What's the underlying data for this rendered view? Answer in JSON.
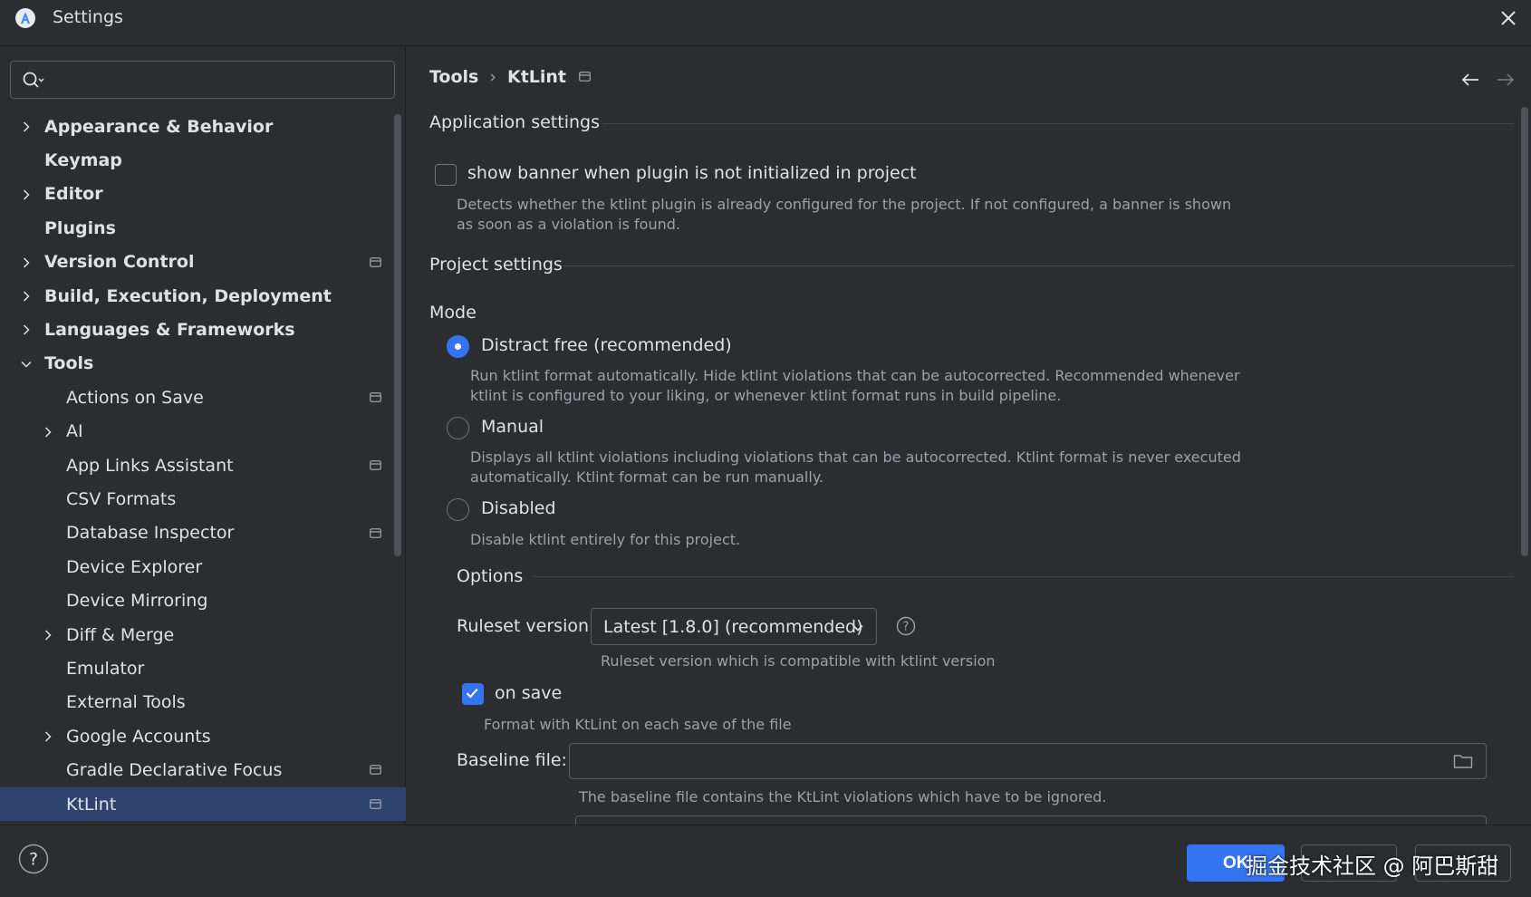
{
  "window": {
    "title": "Settings"
  },
  "search": {
    "placeholder": ""
  },
  "sidebar": {
    "items": [
      {
        "label": "Appearance & Behavior",
        "bold": true,
        "level": 0,
        "expandable": true,
        "expanded": false,
        "project": false
      },
      {
        "label": "Keymap",
        "bold": true,
        "level": 0,
        "expandable": false,
        "expanded": false,
        "project": false
      },
      {
        "label": "Editor",
        "bold": true,
        "level": 0,
        "expandable": true,
        "expanded": false,
        "project": false
      },
      {
        "label": "Plugins",
        "bold": true,
        "level": 0,
        "expandable": false,
        "expanded": false,
        "project": false
      },
      {
        "label": "Version Control",
        "bold": true,
        "level": 0,
        "expandable": true,
        "expanded": false,
        "project": true
      },
      {
        "label": "Build, Execution, Deployment",
        "bold": true,
        "level": 0,
        "expandable": true,
        "expanded": false,
        "project": false
      },
      {
        "label": "Languages & Frameworks",
        "bold": true,
        "level": 0,
        "expandable": true,
        "expanded": false,
        "project": false
      },
      {
        "label": "Tools",
        "bold": true,
        "level": 0,
        "expandable": true,
        "expanded": true,
        "project": false
      },
      {
        "label": "Actions on Save",
        "bold": false,
        "level": 1,
        "expandable": false,
        "expanded": false,
        "project": true
      },
      {
        "label": "AI",
        "bold": false,
        "level": 1,
        "expandable": true,
        "expanded": false,
        "project": false
      },
      {
        "label": "App Links Assistant",
        "bold": false,
        "level": 1,
        "expandable": false,
        "expanded": false,
        "project": true
      },
      {
        "label": "CSV Formats",
        "bold": false,
        "level": 1,
        "expandable": false,
        "expanded": false,
        "project": false
      },
      {
        "label": "Database Inspector",
        "bold": false,
        "level": 1,
        "expandable": false,
        "expanded": false,
        "project": true
      },
      {
        "label": "Device Explorer",
        "bold": false,
        "level": 1,
        "expandable": false,
        "expanded": false,
        "project": false
      },
      {
        "label": "Device Mirroring",
        "bold": false,
        "level": 1,
        "expandable": false,
        "expanded": false,
        "project": false
      },
      {
        "label": "Diff & Merge",
        "bold": false,
        "level": 1,
        "expandable": true,
        "expanded": false,
        "project": false
      },
      {
        "label": "Emulator",
        "bold": false,
        "level": 1,
        "expandable": false,
        "expanded": false,
        "project": false
      },
      {
        "label": "External Tools",
        "bold": false,
        "level": 1,
        "expandable": false,
        "expanded": false,
        "project": false
      },
      {
        "label": "Google Accounts",
        "bold": false,
        "level": 1,
        "expandable": true,
        "expanded": false,
        "project": false
      },
      {
        "label": "Gradle Declarative Focus",
        "bold": false,
        "level": 1,
        "expandable": false,
        "expanded": false,
        "project": true
      },
      {
        "label": "KtLint",
        "bold": false,
        "level": 1,
        "expandable": false,
        "expanded": false,
        "project": true,
        "selected": true
      }
    ]
  },
  "breadcrumb": {
    "parent": "Tools",
    "separator": "›",
    "current": "KtLint"
  },
  "application_settings": {
    "title": "Application settings",
    "banner_checkbox": {
      "label": "show banner when plugin is not initialized in project",
      "checked": false,
      "description": "Detects whether the ktlint plugin is already configured for the project. If not configured, a banner is shown as soon as a violation is found."
    }
  },
  "project_settings": {
    "title": "Project settings",
    "mode_label": "Mode",
    "modes": [
      {
        "label": "Distract free (recommended)",
        "selected": true,
        "description": "Run ktlint format automatically. Hide ktlint violations that can be autocorrected. Recommended whenever ktlint is configured to your liking, or whenever ktlint format runs in build pipeline."
      },
      {
        "label": "Manual",
        "selected": false,
        "description": "Displays all ktlint violations including violations that can be autocorrected. Ktlint format is never executed automatically. Ktlint format can be run manually."
      },
      {
        "label": "Disabled",
        "selected": false,
        "description": "Disable ktlint entirely for this project."
      }
    ]
  },
  "options": {
    "title": "Options",
    "ruleset": {
      "label": "Ruleset version",
      "value": "Latest [1.8.0] (recommended)",
      "description": "Ruleset version which is compatible with ktlint version"
    },
    "on_save": {
      "label": "on save",
      "checked": true,
      "description": "Format with KtLint on each save of the file"
    },
    "baseline": {
      "label": "Baseline file:",
      "value": "",
      "description": "The baseline file contains the KtLint violations which have to be ignored."
    }
  },
  "footer": {
    "ok_label": "OK",
    "watermark": "掘金技术社区 @ 阿巴斯甜"
  },
  "colors": {
    "accent": "#3574f0",
    "selection": "#2e436e",
    "background": "#2b2d30"
  }
}
